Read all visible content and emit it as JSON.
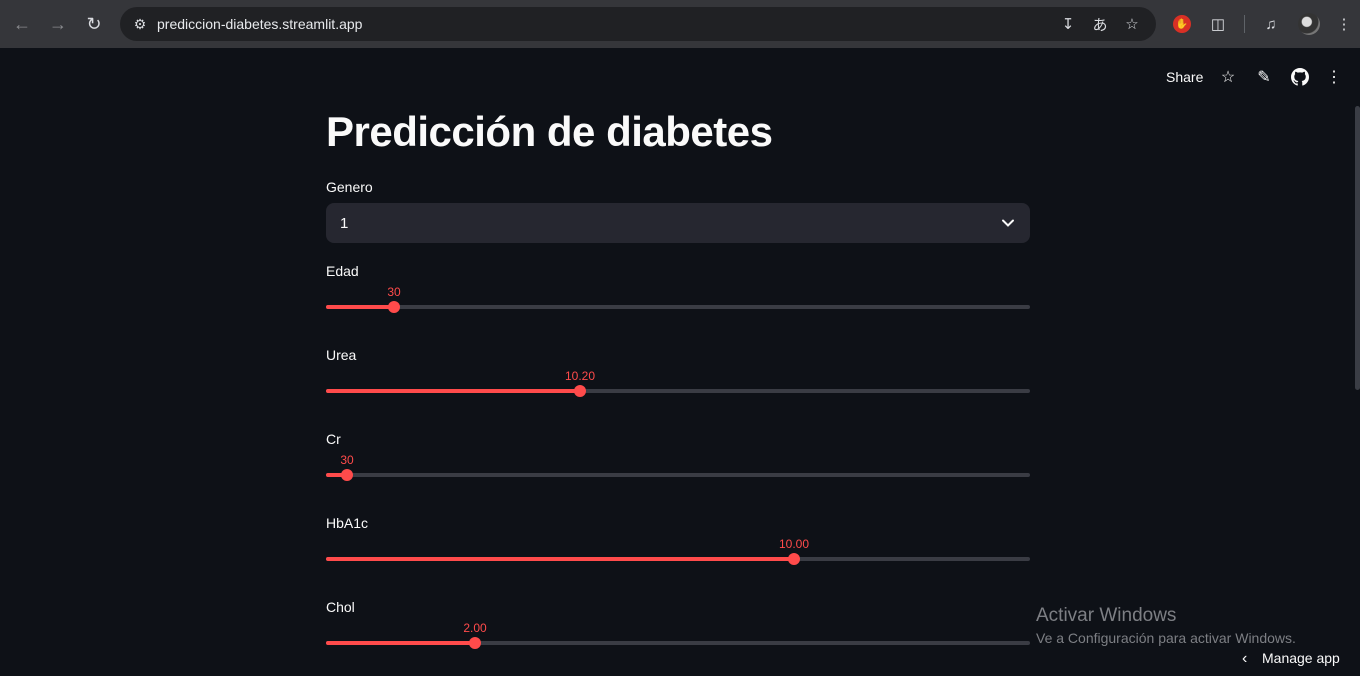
{
  "browser": {
    "url": "prediccion-diabetes.streamlit.app",
    "nav_back_icon": "arrow-left-icon",
    "nav_forward_icon": "arrow-right-icon",
    "reload_icon": "reload-icon"
  },
  "app_toolbar": {
    "share_label": "Share"
  },
  "page": {
    "title": "Predicción de diabetes"
  },
  "genero": {
    "label": "Genero",
    "value": "1"
  },
  "sliders": {
    "edad": {
      "label": "Edad",
      "value_text": "30",
      "fraction": 0.096
    },
    "urea": {
      "label": "Urea",
      "value_text": "10.20",
      "fraction": 0.361
    },
    "cr": {
      "label": "Cr",
      "value_text": "30",
      "fraction": 0.03
    },
    "hba1c": {
      "label": "HbA1c",
      "value_text": "10.00",
      "fraction": 0.665
    },
    "chol": {
      "label": "Chol",
      "value_text": "2.00",
      "fraction": 0.211
    }
  },
  "watermark": {
    "title": "Activar Windows",
    "subtitle": "Ve a Configuración para activar Windows."
  },
  "manage_app": {
    "label": "Manage app"
  },
  "colors": {
    "accent": "#ff4b4b",
    "background": "#0e1117",
    "widget_bg": "#262730"
  }
}
